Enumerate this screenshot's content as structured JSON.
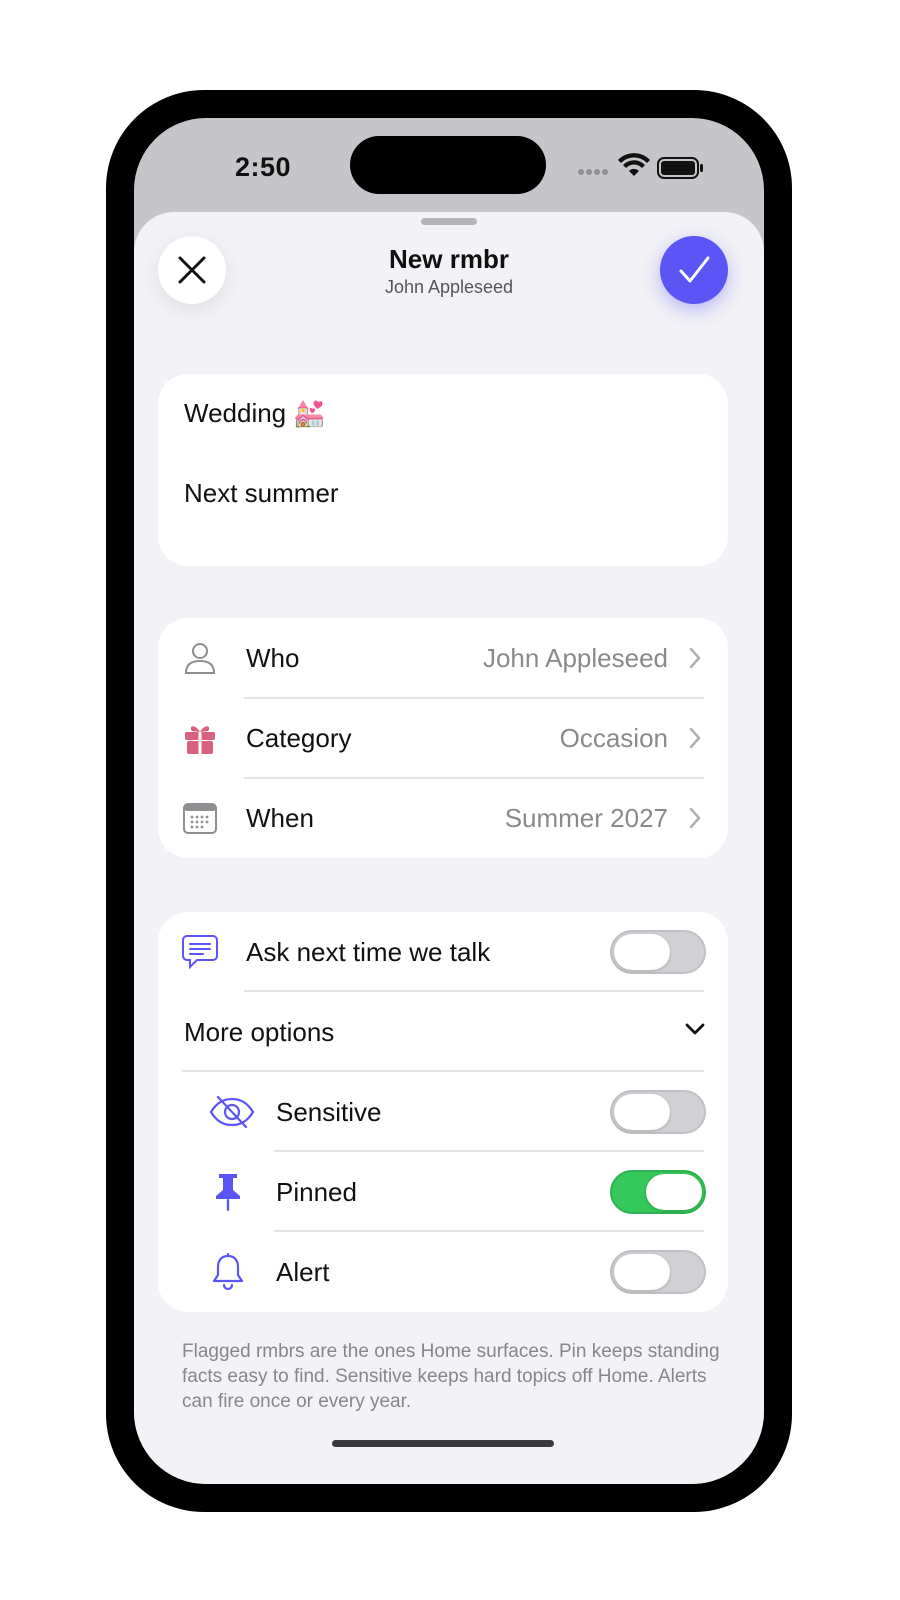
{
  "status_bar": {
    "time": "2:50"
  },
  "header": {
    "title": "New rmbr",
    "subtitle": "John Appleseed",
    "close_icon": "close-icon",
    "confirm_icon": "checkmark-icon",
    "accent_color": "#5b55f6"
  },
  "note": {
    "title": "Wedding 💒",
    "body": "Next summer"
  },
  "details": {
    "rows": [
      {
        "icon": "person-icon",
        "label": "Who",
        "value": "John Appleseed"
      },
      {
        "icon": "gift-icon",
        "label": "Category",
        "value": "Occasion"
      },
      {
        "icon": "calendar-icon",
        "label": "When",
        "value": "Summer 2027"
      }
    ]
  },
  "options": {
    "ask": {
      "icon": "speech-bubble-icon",
      "label": "Ask next time we talk",
      "on": false
    },
    "more_options_label": "More options",
    "items": [
      {
        "icon": "eye-slash-icon",
        "label": "Sensitive",
        "on": false
      },
      {
        "icon": "pin-icon",
        "label": "Pinned",
        "on": true
      },
      {
        "icon": "bell-icon",
        "label": "Alert",
        "on": false
      }
    ]
  },
  "footer_note": "Flagged rmbrs are the ones Home surfaces. Pin keeps standing facts easy to find. Sensitive keeps hard topics off Home. Alerts can fire once or every year.",
  "colors": {
    "toggle_on": "#34c759",
    "gift": "#d9607f",
    "icon_purple": "#5b55f6"
  }
}
